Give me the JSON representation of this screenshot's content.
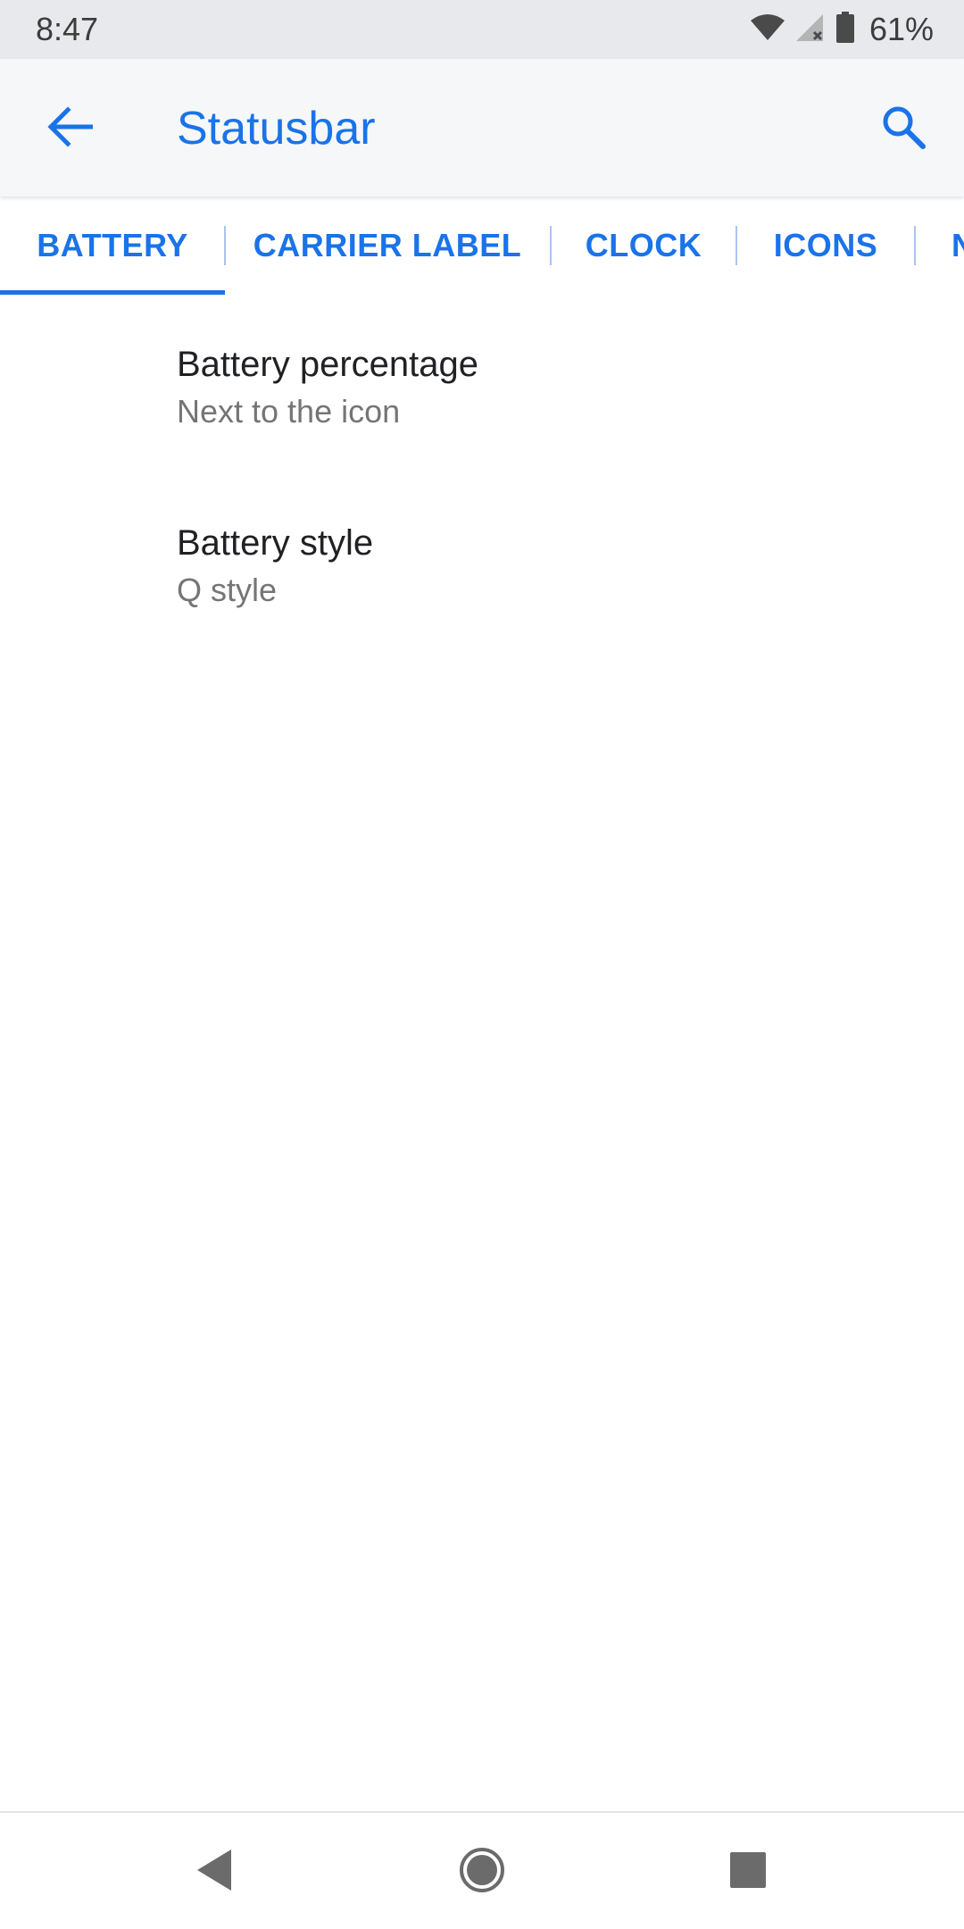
{
  "status_bar": {
    "time": "8:47",
    "battery_percent": "61%",
    "icons": [
      "wifi-icon",
      "signal-icon",
      "battery-icon"
    ]
  },
  "app_bar": {
    "title": "Statusbar",
    "back_icon": "arrow-back-icon",
    "search_icon": "search-icon"
  },
  "tabs": [
    {
      "label": "BATTERY",
      "selected": true
    },
    {
      "label": "CARRIER LABEL",
      "selected": false
    },
    {
      "label": "CLOCK",
      "selected": false
    },
    {
      "label": "ICONS",
      "selected": false
    },
    {
      "label": "N",
      "selected": false
    }
  ],
  "preferences": [
    {
      "title": "Battery percentage",
      "summary": "Next to the icon"
    },
    {
      "title": "Battery style",
      "summary": "Q style"
    }
  ],
  "nav_bar": {
    "icons": [
      "nav-back-icon",
      "nav-home-icon",
      "nav-recents-icon"
    ]
  },
  "colors": {
    "accent": "#1a73e8",
    "status_bar_bg": "#e8e9ec",
    "app_bar_bg": "#f6f7f9",
    "primary_text": "#202124",
    "secondary_text": "#757575"
  }
}
